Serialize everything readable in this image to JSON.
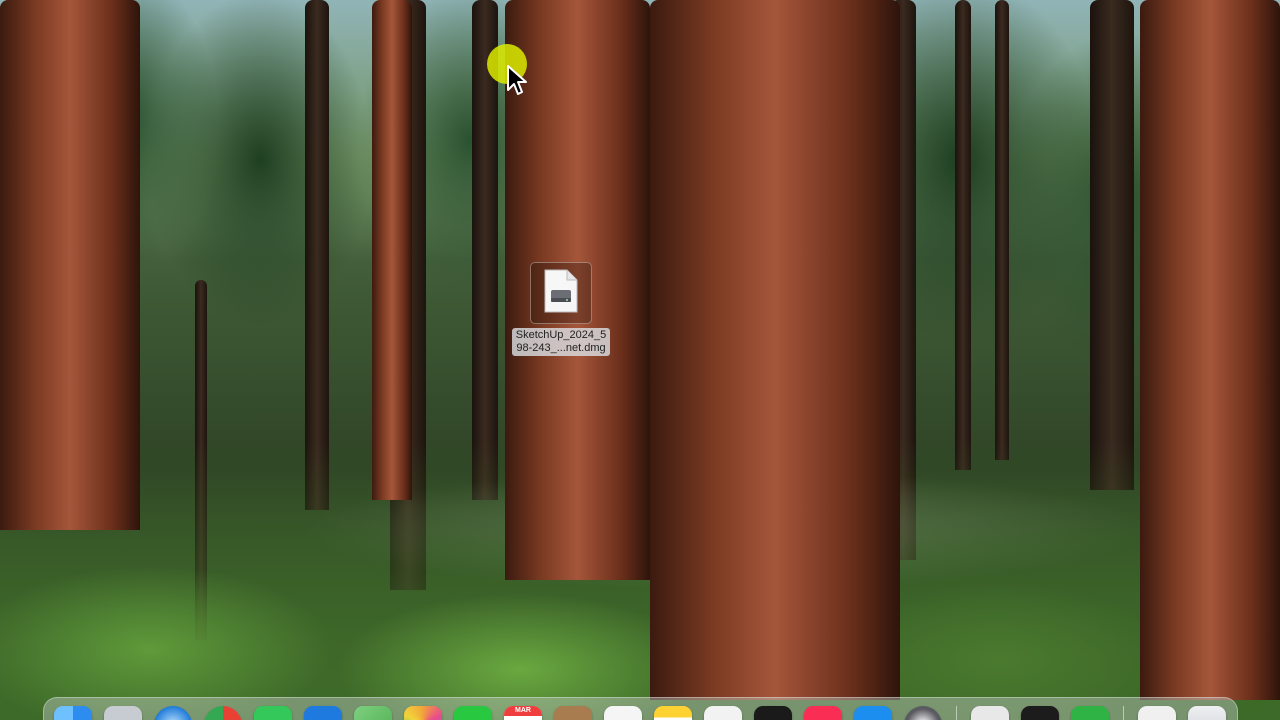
{
  "desktop": {
    "file": {
      "name": "SketchUp_2024_5\n98-243_...net.dmg",
      "icon": "dmg-disk-image-icon"
    }
  },
  "dock": {
    "apps": [
      {
        "name": "finder-icon",
        "color": "#2d8cf0"
      },
      {
        "name": "launchpad-icon",
        "color": "#8a8f99"
      },
      {
        "name": "safari-icon",
        "color": "#1e7ad9"
      },
      {
        "name": "chrome-icon",
        "color": "#e94235"
      },
      {
        "name": "messages-icon",
        "color": "#34c759"
      },
      {
        "name": "mail-icon",
        "color": "#1f7ae0"
      },
      {
        "name": "maps-icon",
        "color": "#4cae4f"
      },
      {
        "name": "photos-icon",
        "color": "#f2a33a"
      },
      {
        "name": "facetime-icon",
        "color": "#28c940"
      },
      {
        "name": "calendar-icon",
        "color": "#ffffff",
        "text": "MAR"
      },
      {
        "name": "contacts-icon",
        "color": "#a87c4f"
      },
      {
        "name": "reminders-icon",
        "color": "#f5f5f5"
      },
      {
        "name": "notes-icon",
        "color": "#ffd233"
      },
      {
        "name": "freeform-icon",
        "color": "#f2f2f2"
      },
      {
        "name": "stocks-icon",
        "color": "#1a1a1a"
      },
      {
        "name": "music-icon",
        "color": "#fa2d55"
      },
      {
        "name": "app-store-icon",
        "color": "#1c8ef0"
      },
      {
        "name": "system-settings-icon",
        "color": "#8e8e93"
      }
    ],
    "extras": [
      {
        "name": "script-editor-icon",
        "color": "#e8e8e8"
      },
      {
        "name": "terminal-icon",
        "color": "#1c1c1c"
      },
      {
        "name": "numbers-icon",
        "color": "#2fb344"
      }
    ],
    "stack": [
      {
        "name": "downloads-document-icon",
        "color": "#f0f0f0"
      },
      {
        "name": "trash-icon",
        "color": "#dcdfe2"
      }
    ]
  }
}
